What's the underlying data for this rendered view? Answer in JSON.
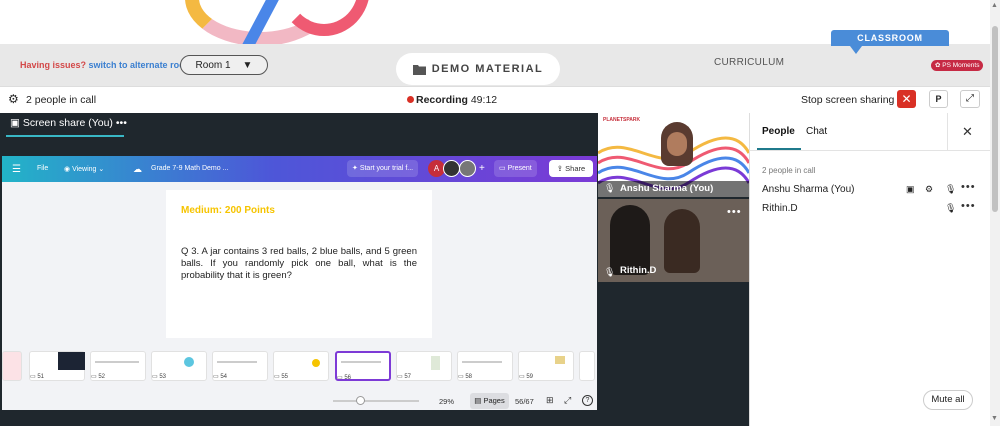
{
  "banner": {
    "issues_text": "Having issues?",
    "alternate_link": "switch to alternate room",
    "room_select": "Room 1",
    "demo_material": "DEMO MATERIAL",
    "curriculum": "CURRICULUM",
    "classroom": "CLASSROOM",
    "ps_moments": "PS Moments"
  },
  "callbar": {
    "people_count": "2 people in call",
    "recording_label": "Recording",
    "recording_time": "49:12",
    "stop_share": "Stop screen sharing",
    "p_button": "P"
  },
  "screenshare": {
    "tab_label": "Screen share (You)",
    "menu": "•••"
  },
  "canva": {
    "file": "File",
    "viewing": "Viewing",
    "doc_title": "Grade 7-9 Math Demo ...",
    "trial": "Start your trial f...",
    "avatar_a": "A",
    "plus": "+",
    "present": "Present",
    "share": "Share"
  },
  "slide": {
    "level": "Medium: 200 Points",
    "question": "Q 3. A jar contains 3 red balls, 2 blue balls, and 5 green balls. If you randomly pick one ball, what is the probability that it is green?"
  },
  "thumbnails": [
    "51",
    "52",
    "53",
    "54",
    "55",
    "56",
    "57",
    "58",
    "59"
  ],
  "zoombar": {
    "zoom": "29%",
    "pages": "Pages",
    "page_of": "56/67",
    "help": "?"
  },
  "video": {
    "tile1_name": "Anshu Sharma (You)",
    "tile1_logo": "PLANETSPARK",
    "tile2_name": "Rithin.D",
    "menu": "•••"
  },
  "panel": {
    "tab_people": "People",
    "tab_chat": "Chat",
    "count": "2 people in call",
    "participants": [
      {
        "name": "Anshu Sharma (You)"
      },
      {
        "name": "Rithin.D"
      }
    ],
    "mute_all": "Mute all"
  }
}
